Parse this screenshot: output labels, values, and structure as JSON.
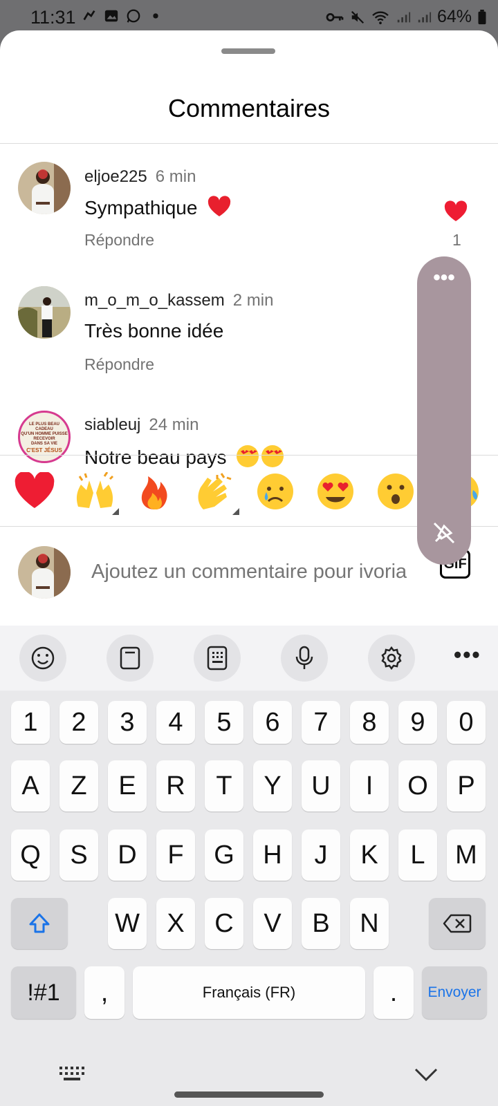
{
  "status": {
    "time": "11:31",
    "battery": "64%"
  },
  "sheet": {
    "title": "Commentaires"
  },
  "comments": [
    {
      "user": "eljoe225",
      "time": "6 min",
      "text": "Sympathique",
      "emoji": "red-heart",
      "reply": "Répondre",
      "likes": "1",
      "liked": true
    },
    {
      "user": "m_o_m_o_kassem",
      "time": "2 min",
      "text": "Très bonne idée",
      "reply": "Répondre"
    },
    {
      "user": "siableuj",
      "time": "24 min",
      "text": "Notre beau pays",
      "emoji": "heart-eyes x2",
      "avatar_text": [
        "LE PLUS BEAU CADEAU",
        "QU'UN HOMME PUISSE RECEVOIR",
        "DANS SA VIE",
        "C'EST JÉSUS"
      ]
    }
  ],
  "quick_emojis": [
    "red-heart",
    "raising-hands",
    "fire",
    "clapping-hands",
    "crying-face",
    "heart-eyes",
    "surprised-face",
    "tears-of-joy"
  ],
  "composer": {
    "placeholder": "Ajoutez un commentaire pour ivoria",
    "gif_label": "GIF"
  },
  "floating_panel": {
    "menu_label": "•••"
  },
  "keyboard": {
    "toolbar": [
      "emoji-icon",
      "clipboard-icon",
      "keypad-icon",
      "microphone-icon",
      "settings-icon",
      "more-icon"
    ],
    "row_numbers": [
      "1",
      "2",
      "3",
      "4",
      "5",
      "6",
      "7",
      "8",
      "9",
      "0"
    ],
    "row1": [
      "A",
      "Z",
      "E",
      "R",
      "T",
      "Y",
      "U",
      "I",
      "O",
      "P"
    ],
    "row2": [
      "Q",
      "S",
      "D",
      "F",
      "G",
      "H",
      "J",
      "K",
      "L",
      "M"
    ],
    "row3": [
      "W",
      "X",
      "C",
      "V",
      "B",
      "N"
    ],
    "symbols": "!#1",
    "comma": ",",
    "space": "Français (FR)",
    "period": ".",
    "send": "Envoyer"
  }
}
